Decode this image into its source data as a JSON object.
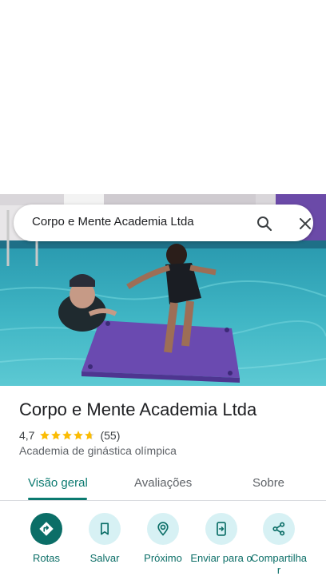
{
  "colors": {
    "accent": "#0b7a70",
    "accent_dark": "#0b6e67",
    "chip_bg": "#d7f1f4",
    "star": "#fbbc04"
  },
  "hero": {
    "description_icon": "pool-photo"
  },
  "search": {
    "query": "Corpo e Mente Academia Ltda",
    "search_icon": "search-icon",
    "close_icon": "close-icon"
  },
  "place": {
    "name": "Corpo e Mente Academia Ltda",
    "rating": "4,7",
    "stars": 4.7,
    "review_count": "(55)",
    "category": "Academia de ginástica olímpica"
  },
  "tabs": [
    {
      "label": "Visão geral",
      "active": true
    },
    {
      "label": "Avaliações",
      "active": false
    },
    {
      "label": "Sobre",
      "active": false
    }
  ],
  "actions": [
    {
      "label": "Rotas",
      "icon": "directions-icon"
    },
    {
      "label": "Salvar",
      "icon": "bookmark-icon"
    },
    {
      "label": "Próximo",
      "icon": "nearby-icon"
    },
    {
      "label": "Enviar para o",
      "icon": "send-to-phone-icon"
    },
    {
      "label": "Compartilha r",
      "icon": "share-icon"
    }
  ]
}
